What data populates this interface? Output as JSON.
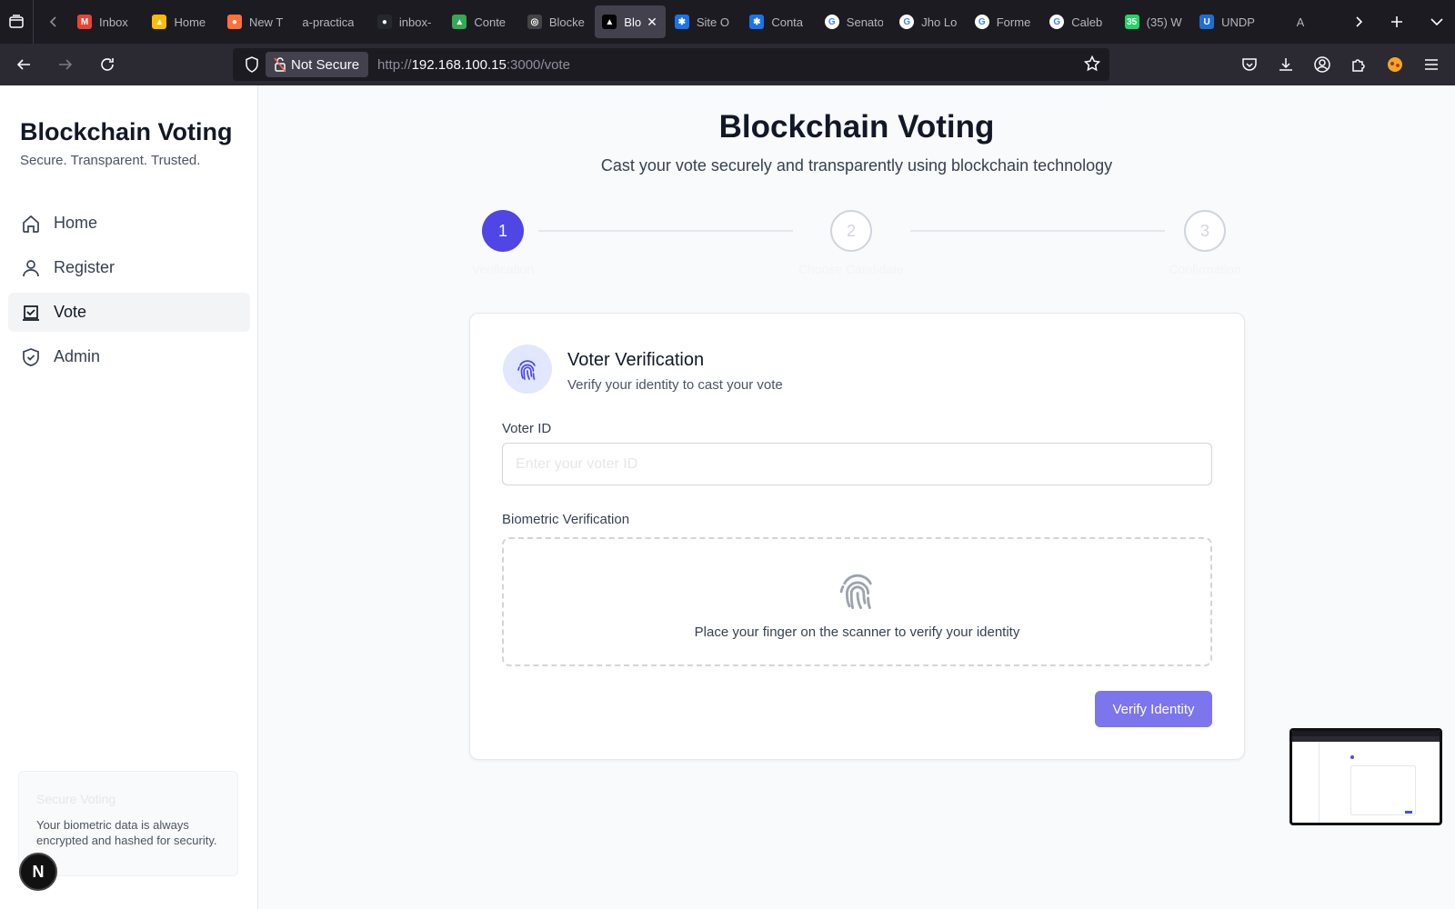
{
  "browser": {
    "tabs": [
      {
        "label": "Inbox",
        "icon": "gmail-icon",
        "color": "#ea4335",
        "glyph": "M"
      },
      {
        "label": "Home",
        "icon": "drive-icon",
        "color": "#fbbc04",
        "glyph": "▲"
      },
      {
        "label": "New T",
        "icon": "firefox-icon",
        "color": "#ff7139",
        "glyph": "●"
      },
      {
        "label": "a-practica",
        "icon": "none",
        "color": "#1c1b22",
        "glyph": ""
      },
      {
        "label": "inbox-",
        "icon": "github-icon",
        "color": "#24292f",
        "glyph": "●"
      },
      {
        "label": "Conte",
        "icon": "drive-icon",
        "color": "#34a853",
        "glyph": "▲"
      },
      {
        "label": "Blocke",
        "icon": "openai-icon",
        "color": "#444",
        "glyph": "◎"
      },
      {
        "label": "Blo",
        "icon": "vercel-icon",
        "color": "#000",
        "glyph": "▲",
        "active": true
      },
      {
        "label": "Site O",
        "icon": "snowflake-icon",
        "color": "#1a73e8",
        "glyph": "✱"
      },
      {
        "label": "Conta",
        "icon": "snowflake-icon",
        "color": "#1a73e8",
        "glyph": "✱"
      },
      {
        "label": "Senato",
        "icon": "google-icon",
        "color": "#fff",
        "glyph": "G"
      },
      {
        "label": "Jho Lo",
        "icon": "google-icon",
        "color": "#fff",
        "glyph": "G"
      },
      {
        "label": "Forme",
        "icon": "google-icon",
        "color": "#fff",
        "glyph": "G"
      },
      {
        "label": "Caleb",
        "icon": "google-icon",
        "color": "#fff",
        "glyph": "G"
      },
      {
        "label": "(35) W",
        "icon": "whatsapp-icon",
        "color": "#25d366",
        "glyph": "35"
      },
      {
        "label": "UNDP",
        "icon": "undp-icon",
        "color": "#1f6fd0",
        "glyph": "U"
      },
      {
        "label": "A",
        "icon": "leaf-icon",
        "color": "#1c1b22",
        "glyph": ""
      }
    ],
    "security_label": "Not Secure",
    "url_prefix": "http://",
    "url_host": "192.168.100.15",
    "url_rest": ":3000/vote"
  },
  "sidebar": {
    "title": "Blockchain Voting",
    "subtitle": "Secure. Transparent. Trusted.",
    "items": [
      {
        "label": "Home",
        "icon": "home-icon"
      },
      {
        "label": "Register",
        "icon": "user-icon"
      },
      {
        "label": "Vote",
        "icon": "vote-icon",
        "active": true
      },
      {
        "label": "Admin",
        "icon": "shield-check-icon"
      }
    ],
    "secure_card": {
      "title": "Secure Voting",
      "text": "Your biometric data is always encrypted and hashed for security."
    },
    "badge": "N"
  },
  "main": {
    "title": "Blockchain Voting",
    "subtitle": "Cast your vote securely and transparently using blockchain technology",
    "steps": [
      {
        "number": "1",
        "label": "Verification",
        "active": true
      },
      {
        "number": "2",
        "label": "Choose Candidate",
        "active": false
      },
      {
        "number": "3",
        "label": "Confirmation",
        "active": false
      }
    ],
    "card": {
      "title": "Voter Verification",
      "subtitle": "Verify your identity to cast your vote",
      "voter_id_label": "Voter ID",
      "voter_id_value": "",
      "voter_id_placeholder": "Enter your voter ID",
      "biometric_label": "Biometric Verification",
      "scan_text": "Place your finger on the scanner to verify your identity",
      "button": "Verify Identity"
    }
  },
  "colors": {
    "accent": "#4f46e5",
    "button": "#7c75ec"
  }
}
